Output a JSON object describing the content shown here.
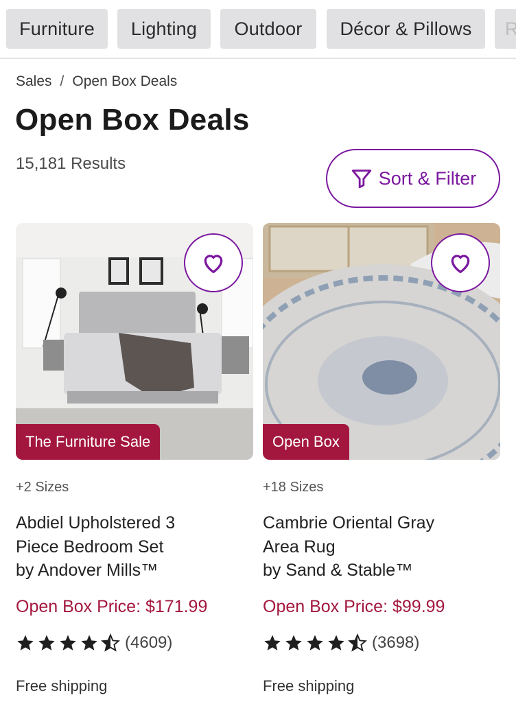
{
  "categories": [
    "Furniture",
    "Lighting",
    "Outdoor",
    "Décor & Pillows",
    "R"
  ],
  "breadcrumb": {
    "parent": "Sales",
    "separator": "/",
    "current": "Open Box Deals"
  },
  "page": {
    "title": "Open Box Deals",
    "results": "15,181 Results"
  },
  "sort_filter": {
    "label": "Sort & Filter",
    "icon": "filter-funnel-icon"
  },
  "colors": {
    "accent": "#7b189f",
    "price": "#a3173e",
    "badge": "#a3173e",
    "chip_bg": "#e1e1e3"
  },
  "products": [
    {
      "badge": "The Furniture Sale",
      "sizes": "+2 Sizes",
      "name_line1": "Abdiel Upholstered 3",
      "name_line2": "Piece Bedroom Set",
      "brand": "by Andover Mills™",
      "price": "Open Box Price: $171.99",
      "rating": 4.5,
      "review_count": "(4609)",
      "shipping": "Free shipping",
      "image": "upholstered-bed-photo"
    },
    {
      "badge": "Open Box",
      "sizes": "+18 Sizes",
      "name_line1": "Cambrie Oriental Gray",
      "name_line2": "Area Rug",
      "brand": "by Sand & Stable™",
      "price": "Open Box Price: $99.99",
      "rating": 4.5,
      "review_count": "(3698)",
      "shipping": "Free shipping",
      "image": "round-area-rug-photo"
    }
  ]
}
